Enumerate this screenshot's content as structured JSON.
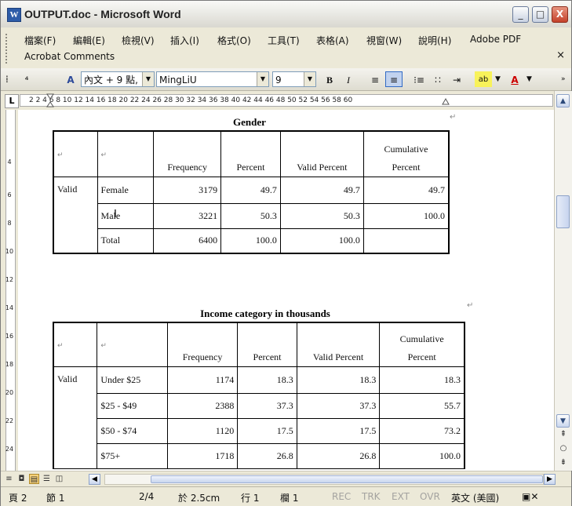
{
  "window": {
    "title": "OUTPUT.doc - Microsoft Word",
    "min_symbol": "_",
    "max_symbol": "□",
    "close_symbol": "X"
  },
  "menu": {
    "items": [
      "檔案(F)",
      "編輯(E)",
      "檢視(V)",
      "插入(I)",
      "格式(O)",
      "工具(T)",
      "表格(A)",
      "視窗(W)",
      "說明(H)",
      "Adobe PDF"
    ],
    "second_row": "Acrobat Comments",
    "close": "×"
  },
  "toolbar": {
    "style_value": "內文 + 9 點, :",
    "font_value": "MingLiU",
    "size_value": "9",
    "bold": "B",
    "italic": "I",
    "font_color_label": "A",
    "highlight_label": "ab"
  },
  "ruler": {
    "tab_selector": "L",
    "numbers": "2    2   4   6   8  10  12  14  16  18  20  22  24  26  28  30  32  34  36  38  40  42  44  46  48  50  52  54  56  58  60"
  },
  "vruler": {
    "numbers": [
      "4",
      "6",
      "8",
      "10",
      "12",
      "14",
      "16",
      "18",
      "20",
      "22",
      "24"
    ]
  },
  "gender_table": {
    "caption": "Gender",
    "headers": [
      "Frequency",
      "Percent",
      "Valid Percent",
      "Cumulative",
      "Percent"
    ],
    "group": "Valid",
    "rows": [
      {
        "label": "Female",
        "frequency": "3179",
        "percent": "49.7",
        "valid": "49.7",
        "cumulative": "49.7"
      },
      {
        "label": "Male",
        "frequency": "3221",
        "percent": "50.3",
        "valid": "50.3",
        "cumulative": "100.0"
      },
      {
        "label": "Total",
        "frequency": "6400",
        "percent": "100.0",
        "valid": "100.0",
        "cumulative": ""
      }
    ]
  },
  "income_table": {
    "caption": "Income category in thousands",
    "headers": [
      "Frequency",
      "Percent",
      "Valid Percent",
      "Cumulative",
      "Percent"
    ],
    "group": "Valid",
    "rows": [
      {
        "label": "Under $25",
        "frequency": "1174",
        "percent": "18.3",
        "valid": "18.3",
        "cumulative": "18.3"
      },
      {
        "label": "$25 - $49",
        "frequency": "2388",
        "percent": "37.3",
        "valid": "37.3",
        "cumulative": "55.7"
      },
      {
        "label": "$50 - $74",
        "frequency": "1120",
        "percent": "17.5",
        "valid": "17.5",
        "cumulative": "73.2"
      },
      {
        "label": "$75+",
        "frequency": "1718",
        "percent": "26.8",
        "valid": "26.8",
        "cumulative": "100.0"
      }
    ]
  },
  "status": {
    "page": "頁 2",
    "section": "節 1",
    "page_of": "2/4",
    "at": "於 2.5cm",
    "line": "行 1",
    "col": "欄 1",
    "rec": "REC",
    "trk": "TRK",
    "ext": "EXT",
    "ovr": "OVR",
    "language": "英文 (美國)"
  }
}
